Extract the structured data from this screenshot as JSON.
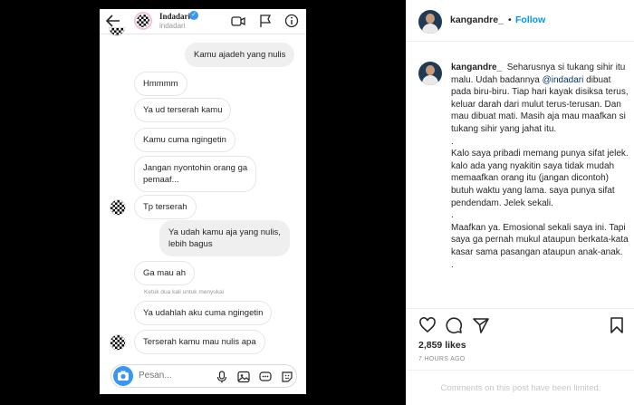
{
  "dm": {
    "header": {
      "display_name": "Indadari",
      "handle": "indadari"
    },
    "messages": [
      {
        "text": "Kamu ajadeh yang nulis"
      },
      {
        "text": "Hmmmm"
      },
      {
        "text": "Ya ud terserah kamu"
      },
      {
        "text": "Kamu cuma ngingetin"
      },
      {
        "line1": "Jangan nyontohin orang ga",
        "line2": "pemaaf..."
      },
      {
        "text": "Tp terserah"
      },
      {
        "line1": "Ya udah kamu aja yang nulis,",
        "line2": "lebih bagus"
      },
      {
        "text": "Ga mau ah"
      },
      {
        "text": "Ya udahlah aku cuma ngingetin"
      },
      {
        "text": "Terserah kamu mau nulis apa"
      }
    ],
    "hint": "Ketuk dua kali untuk menyukai",
    "composer_placeholder": "Pesan..."
  },
  "post": {
    "username": "kangandre_",
    "dot": "•",
    "follow_label": "Follow",
    "caption": {
      "username": "kangandre_",
      "p1_before": "Seharusnya si tukang sihir itu malu. Udah badannya ",
      "mention": "@indadari",
      "p1_after": " dibuat pada biru-biru. Tiap hari kayak disiksa terus, keluar darah dari mulut terus-terusan. Dan mau dibuat mati. Masih aja mau maafkan si tukang sihir yang jahat itu.",
      "dot1": ".",
      "p2": "Kalo saya pribadi memang punya sifat jelek. kalo ada yang nyakitin saya tidak mudah memaafkan orang itu (jangan dicontoh) butuh waktu yang lama. saya punya sifat pendendam. Jelek sekali.",
      "dot2": ".",
      "p3": "Maafkan ya. Emosional sekali saya ini. Tapi saya ga pernah mukul ataupun berkata-kata kasar sama pasangan ataupun anak-anak.",
      "dot3": "."
    },
    "likes": "2,859 likes",
    "date": "7 HOURS AGO",
    "comments_limited": "Comments on this post have been limited."
  }
}
